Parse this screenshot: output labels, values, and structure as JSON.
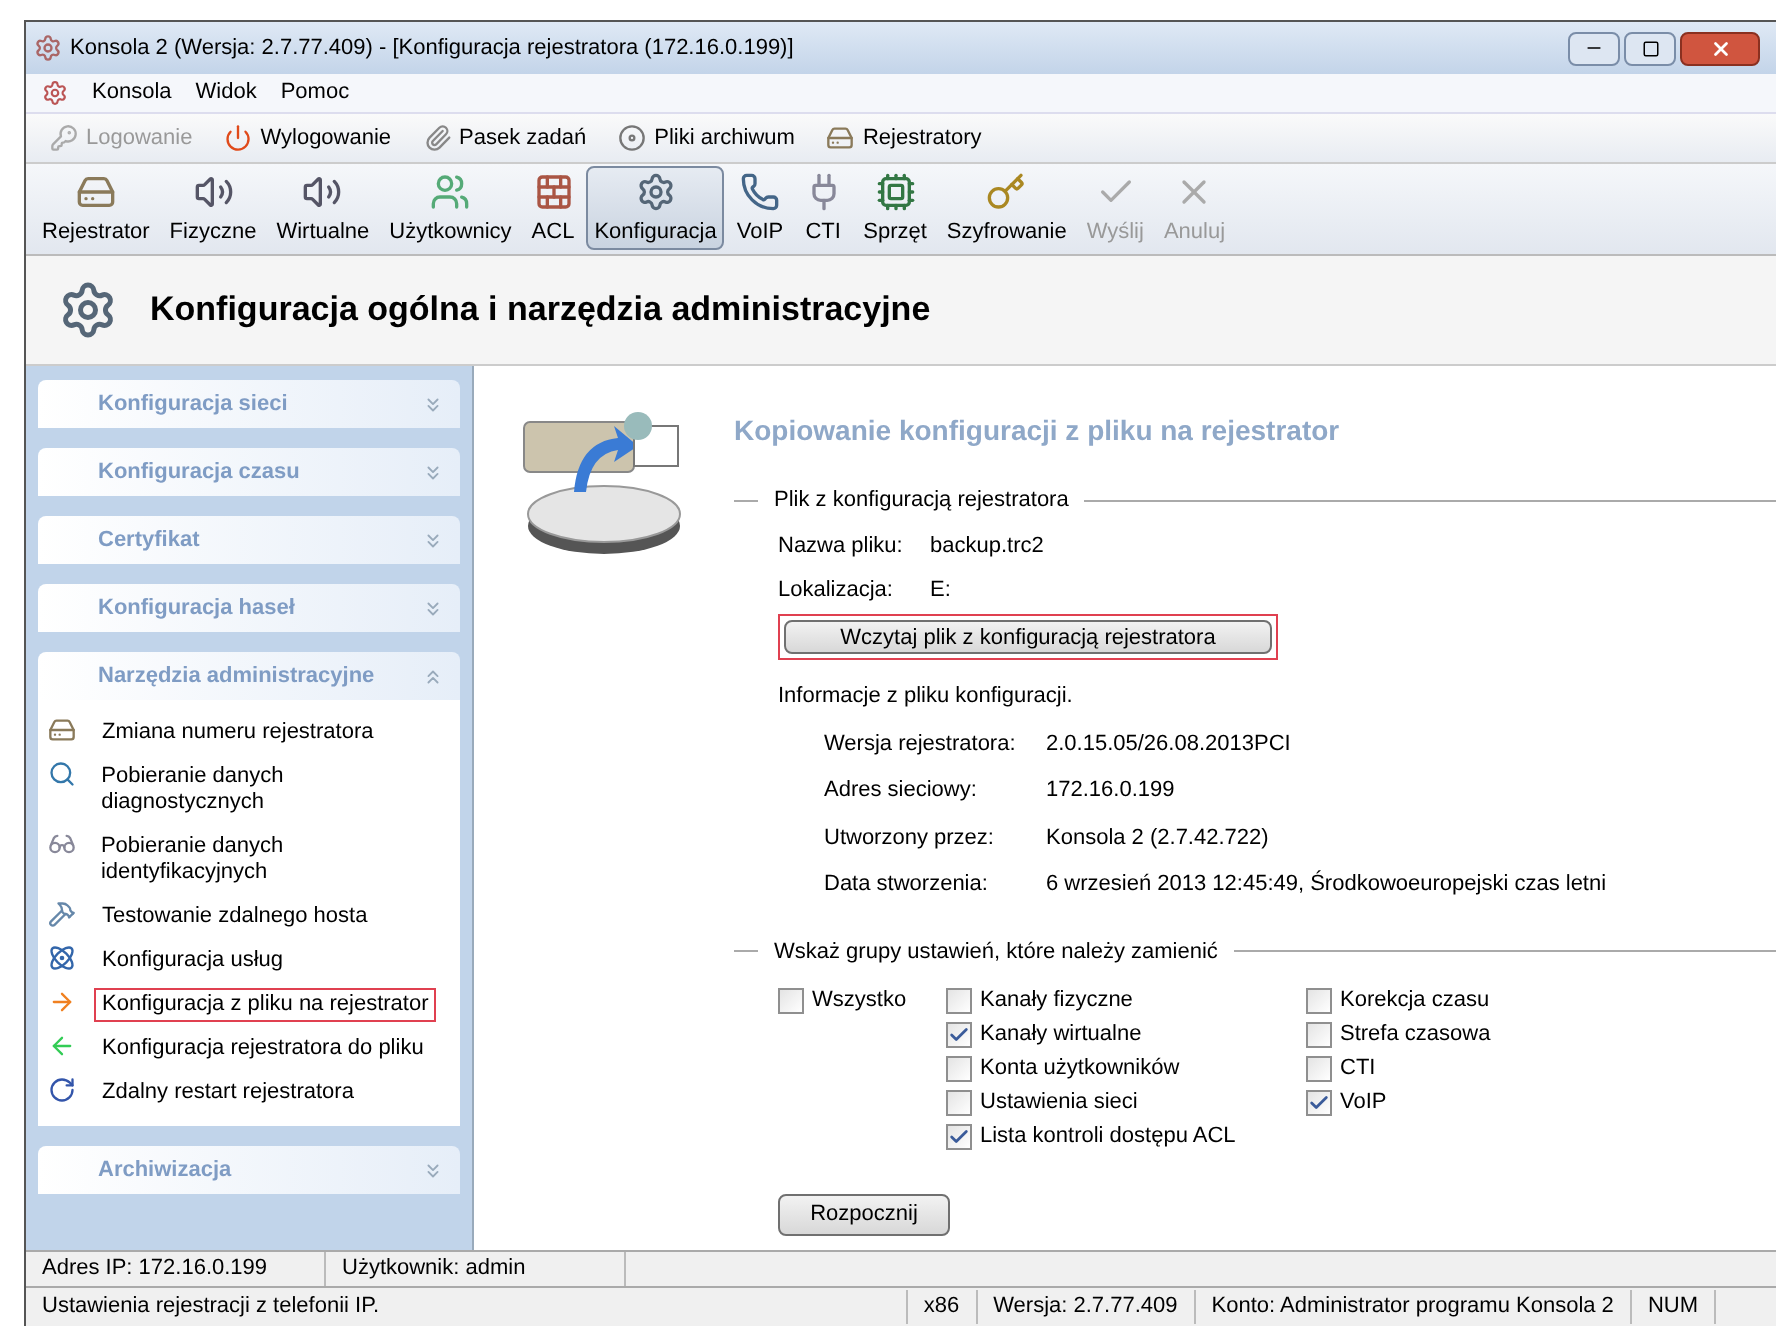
{
  "window": {
    "title": "Konsola 2 (Wersja:  2.7.77.409) - [Konfiguracja rejestratora (172.16.0.199)]"
  },
  "menu": [
    "Konsola",
    "Widok",
    "Pomoc"
  ],
  "quickbar": [
    {
      "label": "Logowanie",
      "disabled": true,
      "kind": "key"
    },
    {
      "label": "Wylogowanie",
      "disabled": false,
      "kind": "power"
    },
    {
      "label": "Pasek zadań",
      "disabled": false,
      "kind": "clip"
    },
    {
      "label": "Pliki archiwum",
      "disabled": false,
      "kind": "disc"
    },
    {
      "label": "Rejestratory",
      "disabled": false,
      "kind": "device"
    }
  ],
  "toolbar": [
    {
      "label": "Rejestrator",
      "kind": "device",
      "selected": false,
      "disabled": false
    },
    {
      "label": "Fizyczne",
      "kind": "speaker",
      "selected": false,
      "disabled": false
    },
    {
      "label": "Wirtualne",
      "kind": "speaker",
      "selected": false,
      "disabled": false
    },
    {
      "label": "Użytkownicy",
      "kind": "users",
      "selected": false,
      "disabled": false
    },
    {
      "label": "ACL",
      "kind": "wall",
      "selected": false,
      "disabled": false
    },
    {
      "label": "Konfiguracja",
      "kind": "config",
      "selected": true,
      "disabled": false
    },
    {
      "label": "VoIP",
      "kind": "phone",
      "selected": false,
      "disabled": false
    },
    {
      "label": "CTI",
      "kind": "plug",
      "selected": false,
      "disabled": false
    },
    {
      "label": "Sprzęt",
      "kind": "card",
      "selected": false,
      "disabled": false
    },
    {
      "label": "Szyfrowanie",
      "kind": "keys",
      "selected": false,
      "disabled": false
    },
    {
      "label": "Wyślij",
      "kind": "check",
      "selected": false,
      "disabled": true
    },
    {
      "label": "Anuluj",
      "kind": "cancel",
      "selected": false,
      "disabled": true
    }
  ],
  "header": {
    "title": "Konfiguracja ogólna i narzędzia administracyjne"
  },
  "sidebar": {
    "sections": [
      {
        "title": "Konfiguracja sieci",
        "expanded": false
      },
      {
        "title": "Konfiguracja czasu",
        "expanded": false
      },
      {
        "title": "Certyfikat",
        "expanded": false
      },
      {
        "title": "Konfiguracja haseł",
        "expanded": false
      },
      {
        "title": "Narzędzia administracyjne",
        "expanded": true,
        "items": [
          {
            "label": "Zmiana numeru rejestratora",
            "kind": "device",
            "selected": false
          },
          {
            "label": "Pobieranie danych diagnostycznych",
            "kind": "search",
            "selected": false
          },
          {
            "label": "Pobieranie danych identyfikacyjnych",
            "kind": "glasses",
            "selected": false
          },
          {
            "label": "Testowanie zdalnego hosta",
            "kind": "hammer",
            "selected": false
          },
          {
            "label": "Konfiguracja usług",
            "kind": "molecule",
            "selected": false
          },
          {
            "label": "Konfiguracja z pliku na rejestrator",
            "kind": "arrow-right",
            "selected": true
          },
          {
            "label": "Konfiguracja rejestratora do pliku",
            "kind": "arrow-left",
            "selected": false
          },
          {
            "label": "Zdalny restart rejestratora",
            "kind": "restart",
            "selected": false
          }
        ]
      },
      {
        "title": "Archiwizacja",
        "expanded": false
      }
    ]
  },
  "content": {
    "title": "Kopiowanie konfiguracji z pliku na rejestrator",
    "file_group": {
      "legend": "Plik z konfiguracją rejestratora",
      "fields": [
        {
          "label": "Nazwa pliku:",
          "value": "backup.trc2"
        },
        {
          "label": "Lokalizacja:",
          "value": "E:"
        }
      ],
      "load_button": "Wczytaj plik z konfiguracją rejestratora",
      "info_heading": "Informacje z pliku konfiguracji.",
      "info": [
        {
          "label": "Wersja rejestratora:",
          "value": "2.0.15.05/26.08.2013PCI"
        },
        {
          "label": "Adres sieciowy:",
          "value": "172.16.0.199"
        },
        {
          "label": "Utworzony przez:",
          "value": "Konsola 2 (2.7.42.722)"
        },
        {
          "label": "Data stworzenia:",
          "value": "6 wrzesień 2013 12:45:49, Środkowoeuropejski czas letni"
        }
      ]
    },
    "groups": {
      "legend": "Wskaż grupy ustawień, które należy zamienić",
      "all": {
        "label": "Wszystko",
        "checked": false
      },
      "columns": [
        [
          {
            "label": "Kanały fizyczne",
            "checked": false
          },
          {
            "label": "Kanały wirtualne",
            "checked": true
          },
          {
            "label": "Konta użytkowników",
            "checked": false
          },
          {
            "label": "Ustawienia sieci",
            "checked": false
          },
          {
            "label": "Lista kontroli dostępu ACL",
            "checked": true
          }
        ],
        [
          {
            "label": "Korekcja czasu",
            "checked": false
          },
          {
            "label": "Strefa czasowa",
            "checked": false
          },
          {
            "label": "CTI",
            "checked": false
          },
          {
            "label": "VoIP",
            "checked": true
          }
        ]
      ]
    },
    "start_button": "Rozpocznij"
  },
  "status_bar": {
    "top": [
      "Adres IP: 172.16.0.199",
      "Użytkownik: admin"
    ],
    "bottom": [
      "Ustawienia rejestracji z telefonii IP.",
      "x86",
      "Wersja: 2.7.77.409",
      "Konto: Administrator programu Konsola 2",
      "NUM"
    ]
  }
}
